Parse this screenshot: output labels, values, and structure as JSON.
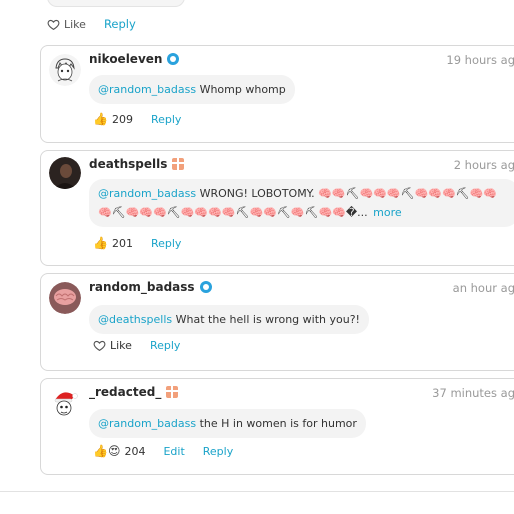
{
  "previous": {
    "like_label": "Like",
    "reply_label": "Reply"
  },
  "comments": [
    {
      "username": "nikoeleven",
      "timestamp": "19 hours ag",
      "mention": "@random_badass",
      "text": " Whomp whomp",
      "reaction_count": "209",
      "reply_label": "Reply"
    },
    {
      "username": "deathspells",
      "timestamp": "2 hours ag",
      "mention": "@random_badass",
      "text_line1": " WRONG! LOBOTOMY. 🧠🧠⛏🧠🧠🧠⛏🧠🧠🧠⛏🧠🧠",
      "text_line2": "🧠⛏🧠🧠🧠⛏🧠🧠🧠🧠⛏🧠🧠⛏🧠⛏🧠🧠�...",
      "more_label": "more",
      "reaction_count": "201",
      "reply_label": "Reply"
    },
    {
      "username": "random_badass",
      "timestamp": "an hour ag",
      "mention": "@deathspells",
      "text": " What the hell is wrong with you?!",
      "like_label": "Like",
      "reply_label": "Reply"
    },
    {
      "username": "_redacted_",
      "timestamp": "37 minutes ag",
      "mention": "@random_badass",
      "text": " the H in women is for humor",
      "reaction_count": "204",
      "edit_label": "Edit",
      "reply_label": "Reply"
    }
  ],
  "menu_glyph": "··",
  "colors": {
    "link": "#1aa3c9",
    "verified": "#2aa2dd",
    "gift": "#f2a07b"
  }
}
